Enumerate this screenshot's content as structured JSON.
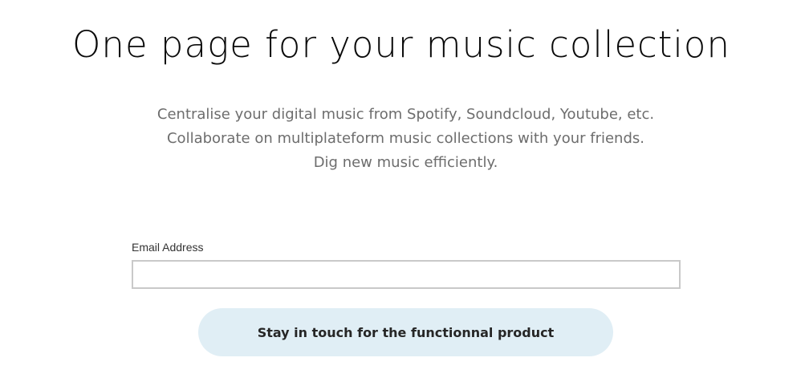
{
  "hero": {
    "title": "One page for your music collection",
    "tagline_lines": [
      "Centralise your digital music from Spotify, Soundcloud, Youtube, etc.",
      "Collaborate on multiplateform music collections with your friends.",
      "Dig new music efficiently."
    ]
  },
  "signup": {
    "email_label": "Email Address",
    "email_value": "",
    "email_placeholder": "",
    "submit_label": "Stay in touch for the functionnal product"
  },
  "colors": {
    "button_background": "#e0eef5",
    "title_text": "#0a0a0a",
    "tagline_text": "#6d6d6d"
  }
}
